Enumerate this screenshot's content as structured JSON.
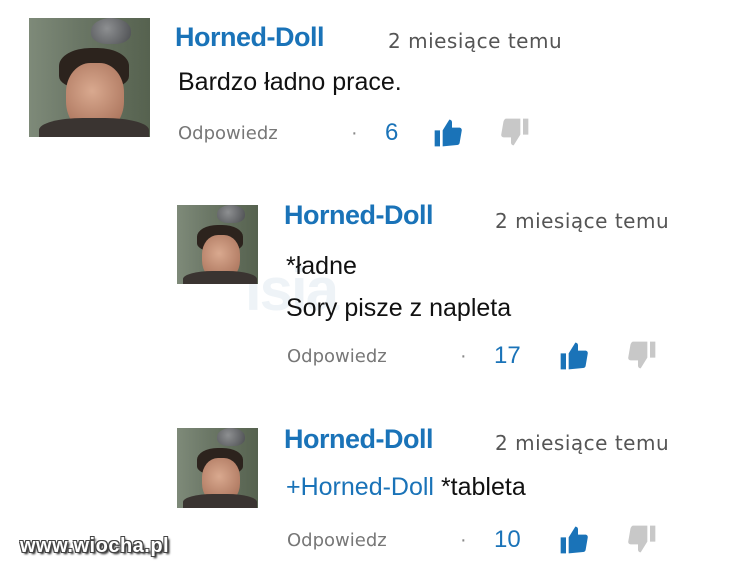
{
  "comments": [
    {
      "author": "Horned-Doll",
      "time": "2 miesiące temu",
      "lines": [
        "Bardzo ładno prace."
      ],
      "reply_label": "Odpowiedz",
      "separator": "·",
      "likes": "6"
    },
    {
      "author": "Horned-Doll",
      "time": "2 miesiące temu",
      "lines": [
        "*ładne",
        "Sory pisze z napleta"
      ],
      "reply_label": "Odpowiedz",
      "separator": "·",
      "likes": "17"
    },
    {
      "author": "Horned-Doll",
      "time": "2 miesiące temu",
      "mention": "+Horned-Doll",
      "lines": [
        "*tableta"
      ],
      "reply_label": "Odpowiedz",
      "separator": "·",
      "likes": "10"
    }
  ],
  "watermark": "www.wiocha.pl",
  "colors": {
    "author": "#1a73b8",
    "like_thumb": "#1a73b8",
    "dislike_thumb": "#c8c8c8"
  },
  "icons": {
    "like": "thumbs-up-icon",
    "dislike": "thumbs-down-icon"
  }
}
